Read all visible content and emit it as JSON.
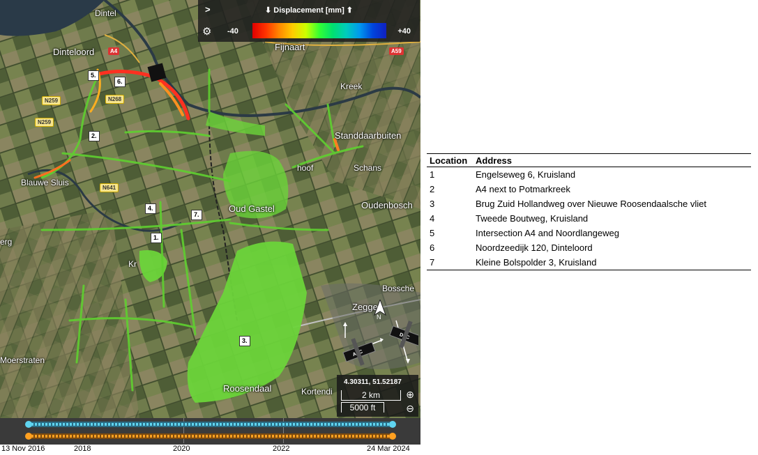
{
  "legend": {
    "title": "⬇ Displacement [mm] ⬆",
    "min": "-40",
    "max": "+40",
    "expand_icon": "chevron-right-icon",
    "settings_icon": "gear-icon"
  },
  "places": {
    "dintel": "Dintel",
    "dinteloord": "Dinteloord",
    "fijnaart": "Fijnaart",
    "kreek": "Kreek",
    "standdaarbuiten": "Standdaarbuiten",
    "schans": "Schans",
    "oudenbosch": "Oudenbosch",
    "oud_gastel": "Oud Gastel",
    "bosschenhoofd": "Bossche",
    "zegge": "Zegge",
    "roosendaal": "Roosendaal",
    "kortendijk": "Kortendi",
    "moerstraten": "Moerstraten",
    "bergen": "erg",
    "kruisland": "Kr",
    "blauwe_sluis": "Blauwe Sluis",
    "hoof": "hoof"
  },
  "road_badges": {
    "a4_top": "A4",
    "a59": "A59",
    "n259_a": "N259",
    "n259_b": "N259",
    "n268": "N268",
    "n641": "N641"
  },
  "markers": [
    "1.",
    "2.",
    "3.",
    "4.",
    "5.",
    "6.",
    "7."
  ],
  "satellite": {
    "asc": "ASC",
    "dsc": "DSC",
    "north": "N"
  },
  "coordbox": {
    "coords": "4.30311, 51.52187",
    "scale_km": "2 km",
    "scale_ft": "5000 ft",
    "zoom_in_icon": "zoom-in-icon",
    "zoom_out_icon": "zoom-out-icon"
  },
  "timeline": {
    "start": "13 Nov 2016",
    "end": "24 Mar 2024",
    "years": [
      "2018",
      "2020",
      "2022"
    ],
    "asc_color": "#5fd4f0",
    "dsc_color": "#ffa020"
  },
  "table": {
    "headers": [
      "Location",
      "Address"
    ],
    "rows": [
      [
        "1",
        "Engelseweg 6, Kruisland"
      ],
      [
        "2",
        "A4 next to Potmarkreek"
      ],
      [
        "3",
        "Brug Zuid Hollandweg over Nieuwe Roosendaalsche vliet"
      ],
      [
        "4",
        "Tweede Boutweg, Kruisland"
      ],
      [
        "5",
        "Intersection A4 and Noordlangeweg"
      ],
      [
        "6",
        "Noordzeedijk 120, Dinteloord"
      ],
      [
        "7",
        "Kleine Bolspolder 3, Kruisland"
      ]
    ]
  }
}
